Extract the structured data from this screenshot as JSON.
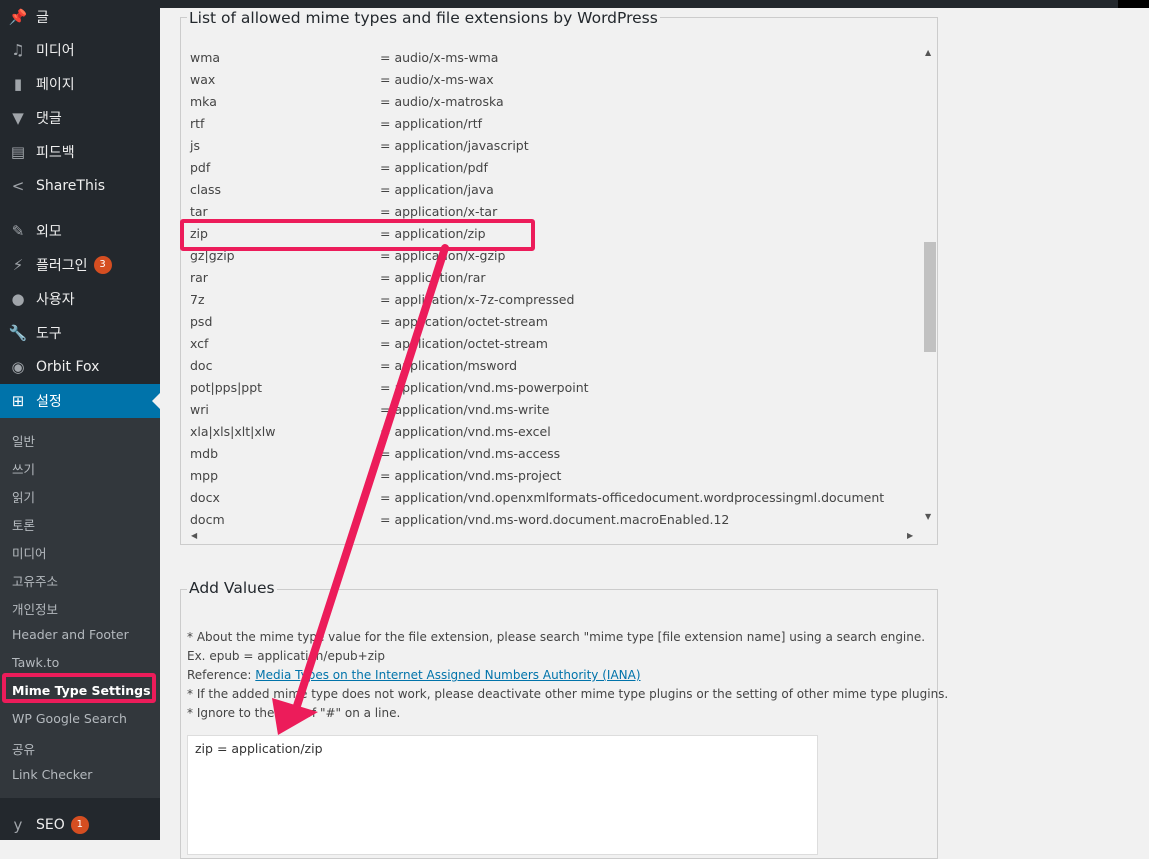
{
  "sidebar": {
    "menu": [
      {
        "label": "글",
        "icon": "pin-icon"
      },
      {
        "label": "미디어",
        "icon": "media-icon"
      },
      {
        "label": "페이지",
        "icon": "page-icon"
      },
      {
        "label": "댓글",
        "icon": "comment-icon"
      },
      {
        "label": "피드백",
        "icon": "feedback-icon"
      },
      {
        "label": "ShareThis",
        "icon": "share-icon"
      },
      {
        "label": "외모",
        "icon": "appearance-icon"
      },
      {
        "label": "플러그인",
        "icon": "plugin-icon",
        "badge": "3"
      },
      {
        "label": "사용자",
        "icon": "user-icon"
      },
      {
        "label": "도구",
        "icon": "wrench-icon"
      },
      {
        "label": "Orbit Fox",
        "icon": "fox-icon"
      },
      {
        "label": "설정",
        "icon": "settings-icon"
      }
    ],
    "submenu": [
      "일반",
      "쓰기",
      "읽기",
      "토론",
      "미디어",
      "고유주소",
      "개인정보",
      "Header and Footer",
      "Tawk.to",
      "Mime Type Settings",
      "WP Google Search",
      "공유",
      "Link Checker"
    ],
    "seo": {
      "label": "SEO",
      "icon": "yoast-icon",
      "badge": "1"
    }
  },
  "mime_section": {
    "legend": "List of allowed mime types and file extensions by WordPress",
    "rows": [
      {
        "ext": "wma",
        "type": "= audio/x-ms-wma"
      },
      {
        "ext": "wax",
        "type": "= audio/x-ms-wax"
      },
      {
        "ext": "mka",
        "type": "= audio/x-matroska"
      },
      {
        "ext": "rtf",
        "type": "= application/rtf"
      },
      {
        "ext": "js",
        "type": "= application/javascript"
      },
      {
        "ext": "pdf",
        "type": "= application/pdf"
      },
      {
        "ext": "class",
        "type": "= application/java"
      },
      {
        "ext": "tar",
        "type": "= application/x-tar"
      },
      {
        "ext": "zip",
        "type": "= application/zip"
      },
      {
        "ext": "gz|gzip",
        "type": "= application/x-gzip"
      },
      {
        "ext": "rar",
        "type": "= application/rar"
      },
      {
        "ext": "7z",
        "type": "= application/x-7z-compressed"
      },
      {
        "ext": "psd",
        "type": "= application/octet-stream"
      },
      {
        "ext": "xcf",
        "type": "= application/octet-stream"
      },
      {
        "ext": "doc",
        "type": "= application/msword"
      },
      {
        "ext": "pot|pps|ppt",
        "type": "= application/vnd.ms-powerpoint"
      },
      {
        "ext": "wri",
        "type": "= application/vnd.ms-write"
      },
      {
        "ext": "xla|xls|xlt|xlw",
        "type": "= application/vnd.ms-excel"
      },
      {
        "ext": "mdb",
        "type": "= application/vnd.ms-access"
      },
      {
        "ext": "mpp",
        "type": "= application/vnd.ms-project"
      },
      {
        "ext": "docx",
        "type": "= application/vnd.openxmlformats-officedocument.wordprocessingml.document"
      },
      {
        "ext": "docm",
        "type": "= application/vnd.ms-word.document.macroEnabled.12"
      }
    ]
  },
  "add_values": {
    "legend": "Add Values",
    "line1": "* About the mime type value for the file extension, please search \"mime type [file extension name] using a search engine.",
    "line2": "Ex. epub = application/epub+zip",
    "line3_prefix": "Reference: ",
    "line3_link": "Media Types on the Internet Assigned Numbers Authority (IANA)",
    "line4": "* If the added mime type does not work, please deactivate other mime type plugins or the setting of other mime type plugins.",
    "line5": "* Ignore to the end of \"#\" on a line.",
    "textarea_value": "zip = application/zip"
  },
  "colors": {
    "annotation": "#ec1c5a",
    "accent": "#0073aa",
    "sidebar": "#23282d"
  }
}
